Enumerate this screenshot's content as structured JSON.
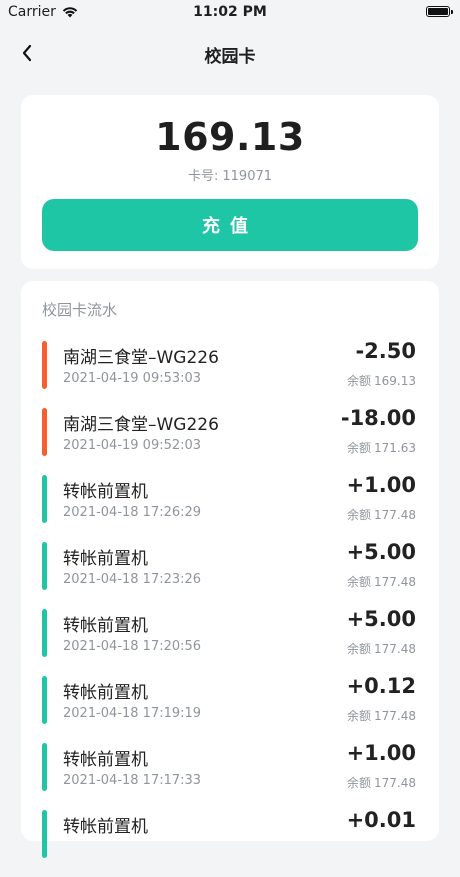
{
  "status": {
    "carrier": "Carrier",
    "time": "11:02 PM"
  },
  "nav": {
    "title": "校园卡"
  },
  "balance_card": {
    "balance": "169.13",
    "card_label": "卡号:",
    "card_number": "119071",
    "recharge_label": "充值"
  },
  "flow": {
    "title": "校园卡流水",
    "remain_label": "余额",
    "items": [
      {
        "name": "南湖三食堂–WG226",
        "time": "2021-04-19 09:53:03",
        "amount": "-2.50",
        "remain": "169.13",
        "color": "#f4602c"
      },
      {
        "name": "南湖三食堂–WG226",
        "time": "2021-04-19 09:52:03",
        "amount": "-18.00",
        "remain": "171.63",
        "color": "#f4602c"
      },
      {
        "name": "转帐前置机",
        "time": "2021-04-18 17:26:29",
        "amount": "+1.00",
        "remain": "177.48",
        "color": "#1ec6a6"
      },
      {
        "name": "转帐前置机",
        "time": "2021-04-18 17:23:26",
        "amount": "+5.00",
        "remain": "177.48",
        "color": "#1ec6a6"
      },
      {
        "name": "转帐前置机",
        "time": "2021-04-18 17:20:56",
        "amount": "+5.00",
        "remain": "177.48",
        "color": "#1ec6a6"
      },
      {
        "name": "转帐前置机",
        "time": "2021-04-18 17:19:19",
        "amount": "+0.12",
        "remain": "177.48",
        "color": "#1ec6a6"
      },
      {
        "name": "转帐前置机",
        "time": "2021-04-18 17:17:33",
        "amount": "+1.00",
        "remain": "177.48",
        "color": "#1ec6a6"
      },
      {
        "name": "转帐前置机",
        "time": "",
        "amount": "+0.01",
        "remain": "",
        "color": "#1ec6a6"
      }
    ]
  }
}
